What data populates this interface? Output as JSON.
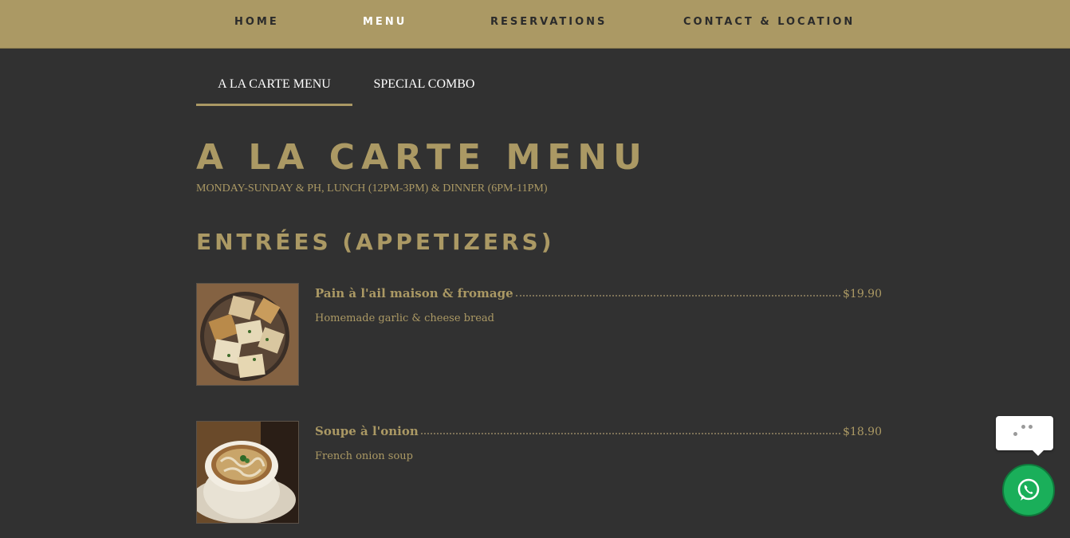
{
  "nav": {
    "items": [
      {
        "label": "HOME",
        "active": false
      },
      {
        "label": "MENU",
        "active": true
      },
      {
        "label": "RESERVATIONS",
        "active": false
      },
      {
        "label": "CONTACT & LOCATION",
        "active": false
      }
    ]
  },
  "tabs": [
    {
      "label": "A LA CARTE MENU",
      "active": true
    },
    {
      "label": "SPECIAL COMBO",
      "active": false
    }
  ],
  "menu": {
    "title": "A LA CARTE MENU",
    "subtitle": "MONDAY-SUNDAY & PH, LUNCH (12PM-3PM) & DINNER (6PM-11PM)",
    "section": {
      "title": "ENTRÉES (APPETIZERS)",
      "items": [
        {
          "name": "Pain à l'ail maison & fromage",
          "price": "$19.90",
          "description": "Homemade garlic & cheese bread",
          "photo": "garlic-cheese-bread-photo"
        },
        {
          "name": "Soupe à l'onion",
          "price": "$18.90",
          "description": "French onion soup",
          "photo": "onion-soup-photo"
        }
      ]
    }
  },
  "widgets": {
    "chat_icon": "chat-dots-icon",
    "whatsapp_icon": "whatsapp-icon"
  },
  "colors": {
    "nav_bg": "#ab9964",
    "page_bg": "#313131",
    "accent_gold": "#ab9964",
    "whatsapp_green": "#1aaf5a"
  }
}
